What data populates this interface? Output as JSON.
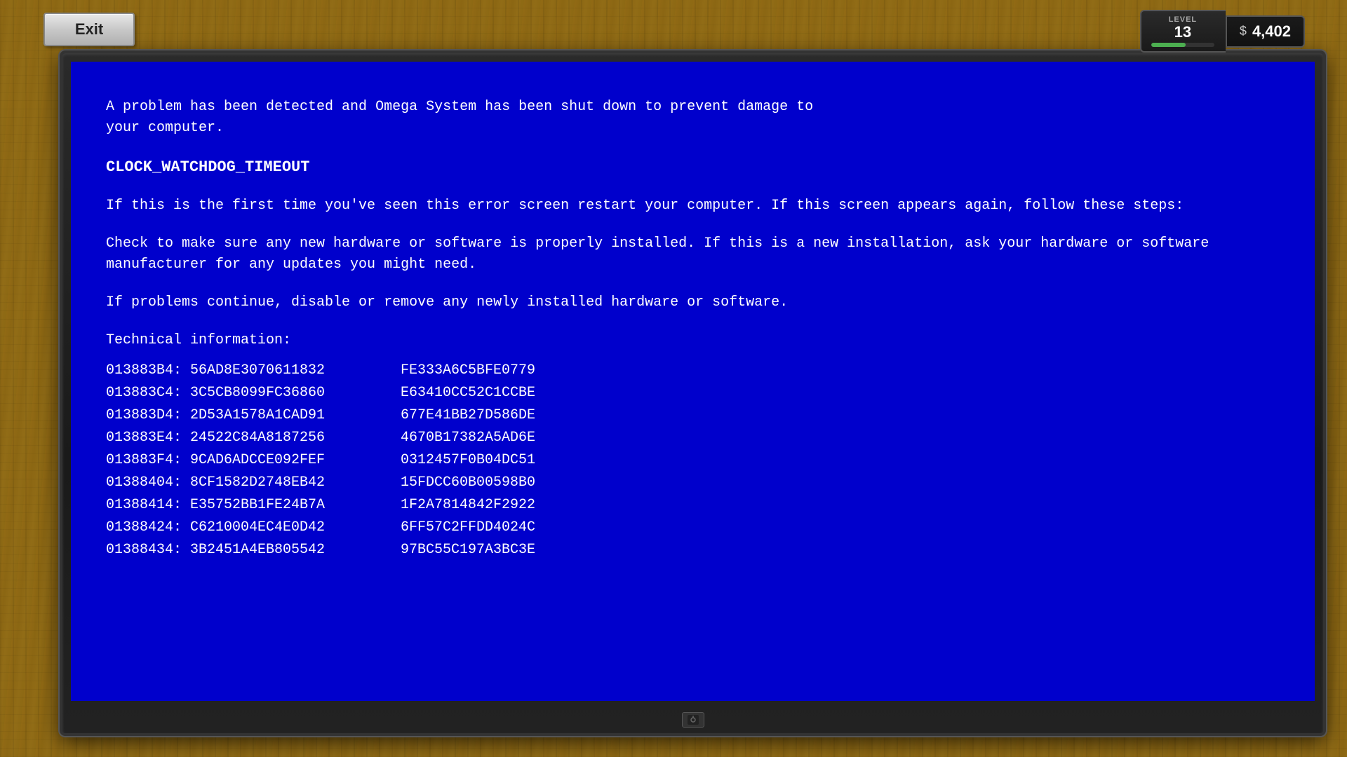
{
  "exit_button": {
    "label": "Exit"
  },
  "hud": {
    "level_label": "LEVEL",
    "level_value": "13",
    "level_progress": 55,
    "money_symbol": "$",
    "money_value": "4,402"
  },
  "bsod": {
    "line1": "A problem has been detected and Omega System has been shut down to prevent damage to",
    "line2": "your computer.",
    "error_code": "CLOCK_WATCHDOG_TIMEOUT",
    "para2": "If this is the first time you've seen this error screen restart your computer. If this screen appears again, follow these steps:",
    "para3": "Check to make sure any new hardware or software is properly installed. If this is a new installation, ask your hardware or software manufacturer for any updates you might need.",
    "para4": "If problems continue, disable or remove any newly installed hardware or software.",
    "tech_title": "Technical information:",
    "tech_rows": [
      {
        "addr": "013883B4:",
        "val1": "56AD8E3070611832",
        "val2": "FE333A6C5BFE0779"
      },
      {
        "addr": "013883C4:",
        "val1": "3C5CB8099FC36860",
        "val2": "E63410CC52C1CCBE"
      },
      {
        "addr": "013883D4:",
        "val1": "2D53A1578A1CAD91",
        "val2": "677E41BB27D586DE"
      },
      {
        "addr": "013883E4:",
        "val1": "24522C84A8187256",
        "val2": "4670B17382A5AD6E"
      },
      {
        "addr": "013883F4:",
        "val1": "9CAD6ADCCE092FEF",
        "val2": "0312457F0B04DC51"
      },
      {
        "addr": "01388404:",
        "val1": "8CF1582D2748EB42",
        "val2": "15FDCC60B00598B0"
      },
      {
        "addr": "01388414:",
        "val1": "E35752BB1FE24B7A",
        "val2": "1F2A7814842F2922"
      },
      {
        "addr": "01388424:",
        "val1": "C6210004EC4E0D42",
        "val2": "6FF57C2FFDD4024C"
      },
      {
        "addr": "01388434:",
        "val1": "3B2451A4EB805542",
        "val2": "97BC55C197A3BC3E"
      }
    ]
  }
}
